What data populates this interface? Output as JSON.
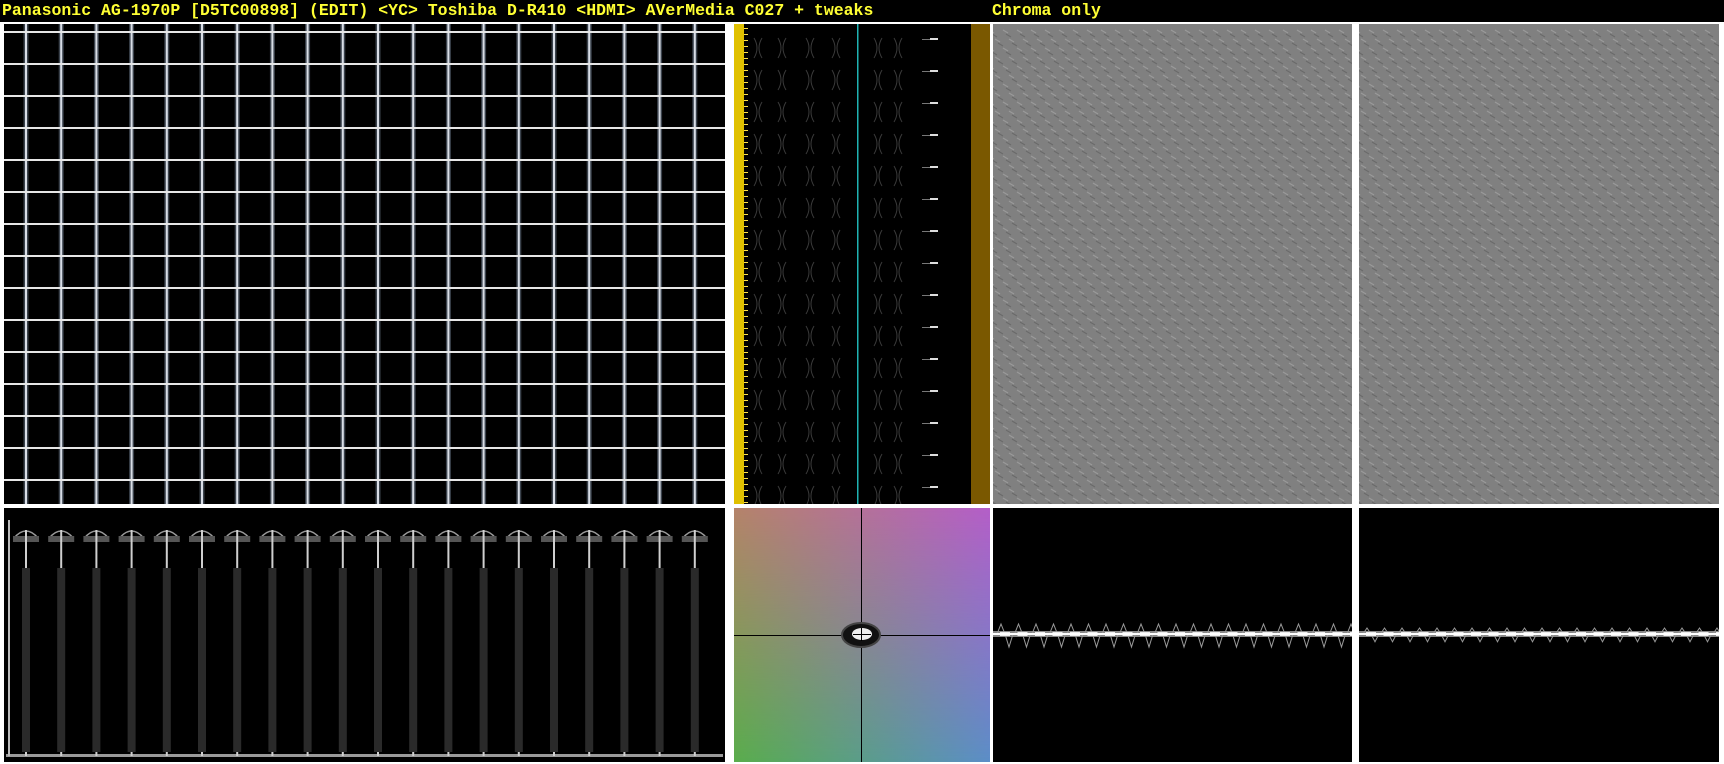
{
  "header": {
    "title": "Panasonic AG-1970P [D5TC00898] (EDIT) <YC> Toshiba D-R410 <HDMI> AVerMedia C027 + tweaks",
    "subtitle": "Chroma only"
  },
  "panels": {
    "grid_view": "crosshatch-pattern",
    "line_analyzer": "line-analyzer",
    "chroma_left": "chroma-only-field",
    "chroma_right": "chroma-only-field",
    "waveform": "luma-waveform",
    "vectorscope": "vectorscope",
    "chroma_wave_left": "chroma-waveform",
    "chroma_wave_right": "chroma-waveform"
  },
  "colors": {
    "title": "#ffff33",
    "grid_line": "#e6e6e6",
    "analyzer_yellow": "#e0c000",
    "analyzer_brown": "#7a5800",
    "analyzer_cyan": "#1fb3b3",
    "chroma_gray": "#808080"
  }
}
